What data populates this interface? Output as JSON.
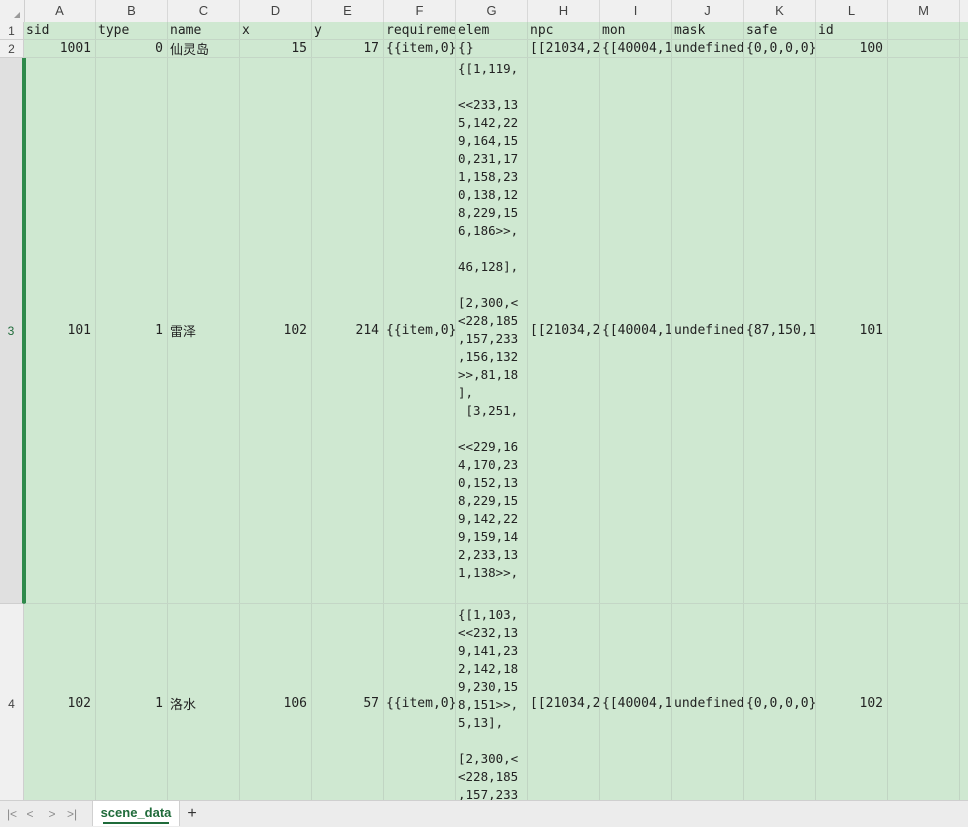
{
  "columns": [
    "A",
    "B",
    "C",
    "D",
    "E",
    "F",
    "G",
    "H",
    "I",
    "J",
    "K",
    "L",
    "M"
  ],
  "row_numbers": [
    "1",
    "2",
    "3",
    "4"
  ],
  "header": {
    "A": "sid",
    "B": "type",
    "C": "name",
    "D": "x",
    "E": "y",
    "F": "requireme",
    "G": "elem",
    "H": "npc",
    "I": "mon",
    "J": "mask",
    "K": "safe",
    "L": "id"
  },
  "row2": {
    "A": "1001",
    "B": "0",
    "C": "仙灵岛",
    "D": "15",
    "E": "17",
    "F": "{{item,0}",
    "G": "{}",
    "H": "[[21034,2",
    "I": "{[40004,1",
    "J": "undefined",
    "K": "{0,0,0,0}",
    "L": "100"
  },
  "row3": {
    "A": "101",
    "B": "1",
    "C": "雷泽",
    "D": "102",
    "E": "214",
    "F": "{{item,0}",
    "G": "{[1,119,\n\n<<233,13\n5,142,22\n9,164,15\n0,231,17\n1,158,23\n0,138,12\n8,229,15\n6,186>>,\n\n46,128],\n\n[2,300,<\n<228,185\n,157,233\n,156,132\n>>,81,18\n],\n [3,251,\n\n<<229,16\n4,170,23\n0,152,13\n8,229,15\n9,142,22\n9,159,14\n2,233,13\n1,138>>,\n\n      ,",
    "H": "[[21034,2",
    "I": "{[40004,1",
    "J": "undefined",
    "K": "{87,150,1",
    "L": "101"
  },
  "row4": {
    "A": "102",
    "B": "1",
    "C": "洛水",
    "D": "106",
    "E": "57",
    "F": "{{item,0}",
    "G": "{[1,103,\n<<232,13\n9,141,23\n2,142,18\n9,230,15\n8,151>>,\n5,13],\n\n[2,300,<\n<228,185\n,157,233",
    "H": "[[21034,2",
    "I": "{[40004,1",
    "J": "undefined",
    "K": "{0,0,0,0}",
    "L": "102"
  },
  "sheet_tab": "scene_data",
  "add_tab": "+",
  "nav": [
    "|<",
    "<",
    ">",
    ">|"
  ],
  "colors": {
    "row_fill": "#cfe8d1",
    "accent": "#1f6b3a"
  }
}
